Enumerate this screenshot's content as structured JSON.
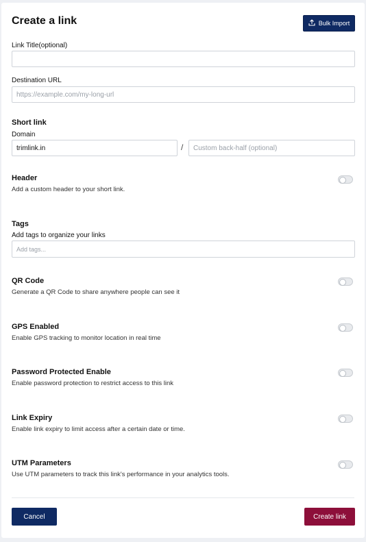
{
  "header": {
    "title": "Create a link",
    "bulk_import_label": "Bulk Import"
  },
  "link_title": {
    "label": "Link Title(optional)",
    "value": "",
    "placeholder": ""
  },
  "destination": {
    "label": "Destination URL",
    "value": "",
    "placeholder": "https://example.com/my-long-url"
  },
  "short_link": {
    "heading": "Short link",
    "domain_label": "Domain",
    "domain_value": "trimlink.in",
    "separator": "/",
    "backhalf_placeholder": "Custom back-half (optional)"
  },
  "header_section": {
    "title": "Header",
    "description": "Add a custom header to your short link.",
    "enabled": false
  },
  "tags": {
    "title": "Tags",
    "label": "Add tags to organize your links",
    "placeholder": "Add tags..."
  },
  "qr": {
    "title": "QR Code",
    "description": "Generate a QR Code to share anywhere people can see it",
    "enabled": false
  },
  "gps": {
    "title": "GPS Enabled",
    "description": "Enable GPS tracking to monitor location in real time",
    "enabled": false
  },
  "password": {
    "title": "Password Protected Enable",
    "description": "Enable password protection to restrict access to this link",
    "enabled": false
  },
  "expiry": {
    "title": "Link Expiry",
    "description": "Enable link expiry to limit access after a certain date or time.",
    "enabled": false
  },
  "utm": {
    "title": "UTM Parameters",
    "description": "Use UTM parameters to track this link's performance in your analytics tools.",
    "enabled": false
  },
  "footer": {
    "cancel_label": "Cancel",
    "create_label": "Create link"
  },
  "colors": {
    "primary": "#0f2a63",
    "create": "#8d0f3a",
    "background": "#eef0f4"
  }
}
